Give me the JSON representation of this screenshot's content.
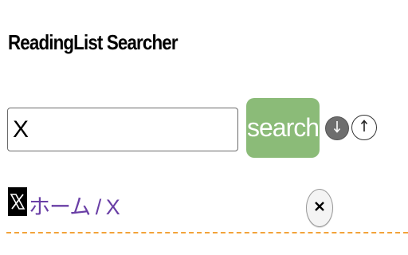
{
  "header": {
    "title": "ReadingList Searcher"
  },
  "search": {
    "value": "X",
    "button_label": "search",
    "sort_down_icon": "arrow-down-circle-icon",
    "sort_up_icon": "arrow-up-circle-icon"
  },
  "results": [
    {
      "favicon": "x-logo-icon",
      "title": "ホーム / X",
      "remove_icon": "close-icon"
    }
  ],
  "colors": {
    "search_button": "#8bbb78",
    "link": "#6a3fa6",
    "divider": "#f2a33a"
  }
}
